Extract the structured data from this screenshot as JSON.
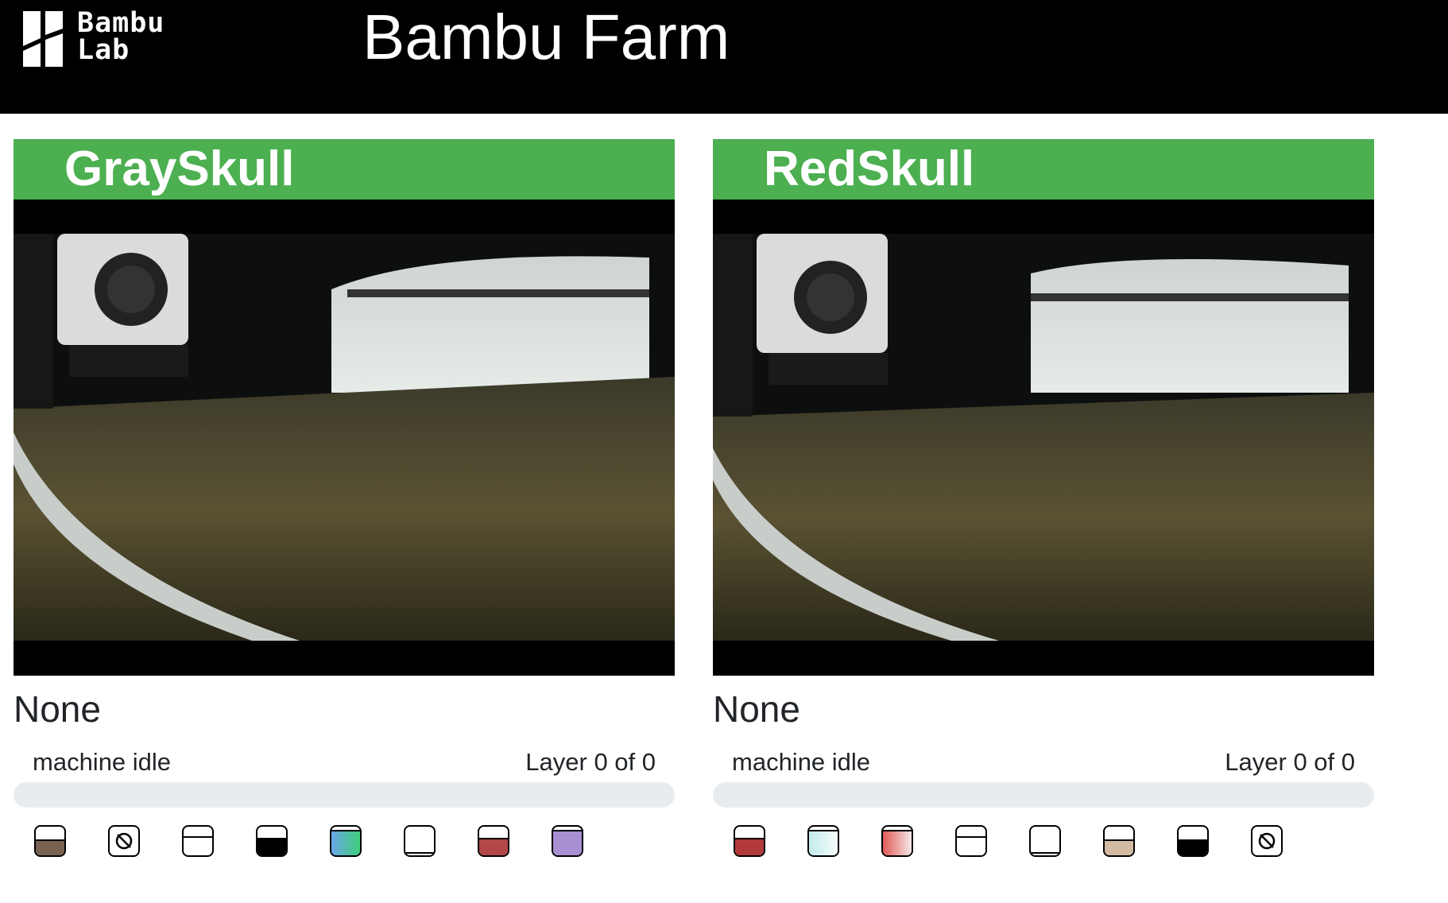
{
  "header": {
    "logo_line1": "Bambu",
    "logo_line2": "Lab",
    "title": "Bambu Farm"
  },
  "printers": [
    {
      "name": "GraySkull",
      "job": "None",
      "status": "machine idle",
      "layer": "Layer 0 of 0",
      "progress_percent": 0,
      "trays": [
        {
          "kind": "half",
          "color": "#7a6253"
        },
        {
          "kind": "empty"
        },
        {
          "kind": "line"
        },
        {
          "kind": "half-high",
          "color": "#000000"
        },
        {
          "kind": "gradient",
          "colors": [
            "#6aa6e8",
            "#3fcf7a"
          ]
        },
        {
          "kind": "bottom-line"
        },
        {
          "kind": "half-high",
          "color": "#b34646"
        },
        {
          "kind": "full",
          "color": "#a88ed2"
        }
      ]
    },
    {
      "name": "RedSkull",
      "job": "None",
      "status": "machine idle",
      "layer": "Layer 0 of 0",
      "progress_percent": 0,
      "trays": [
        {
          "kind": "half-high",
          "color": "#b33a3a"
        },
        {
          "kind": "gradient",
          "colors": [
            "#c3ecec",
            "#f6fcfc"
          ]
        },
        {
          "kind": "gradient",
          "colors": [
            "#e05a56",
            "#f6e9e8"
          ]
        },
        {
          "kind": "line"
        },
        {
          "kind": "bottom-line"
        },
        {
          "kind": "half",
          "color": "#d3bba3"
        },
        {
          "kind": "half",
          "color": "#000000"
        },
        {
          "kind": "empty"
        }
      ]
    }
  ]
}
